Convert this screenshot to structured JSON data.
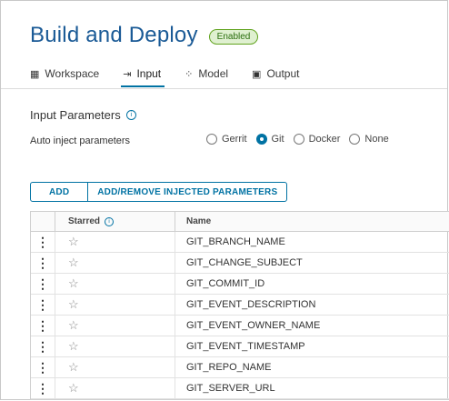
{
  "header": {
    "title": "Build and Deploy",
    "status_badge": "Enabled"
  },
  "tabs": [
    {
      "label": "Workspace",
      "icon": "workspace-icon",
      "active": false
    },
    {
      "label": "Input",
      "icon": "input-icon",
      "active": true
    },
    {
      "label": "Model",
      "icon": "model-icon",
      "active": false
    },
    {
      "label": "Output",
      "icon": "output-icon",
      "active": false
    }
  ],
  "input_parameters": {
    "title": "Input Parameters",
    "auto_inject_label": "Auto inject parameters",
    "options": [
      "Gerrit",
      "Git",
      "Docker",
      "None"
    ],
    "selected": "Git"
  },
  "toolbar": {
    "add_label": "ADD",
    "add_remove_label": "ADD/REMOVE INJECTED PARAMETERS"
  },
  "table": {
    "columns": [
      "Starred",
      "Name"
    ],
    "rows": [
      "GIT_BRANCH_NAME",
      "GIT_CHANGE_SUBJECT",
      "GIT_COMMIT_ID",
      "GIT_EVENT_DESCRIPTION",
      "GIT_EVENT_OWNER_NAME",
      "GIT_EVENT_TIMESTAMP",
      "GIT_REPO_NAME",
      "GIT_SERVER_URL"
    ]
  },
  "colors": {
    "accent": "#0072a3",
    "title": "#1a5a96",
    "badge_bg": "#dff0d0",
    "badge_border": "#62a420"
  }
}
